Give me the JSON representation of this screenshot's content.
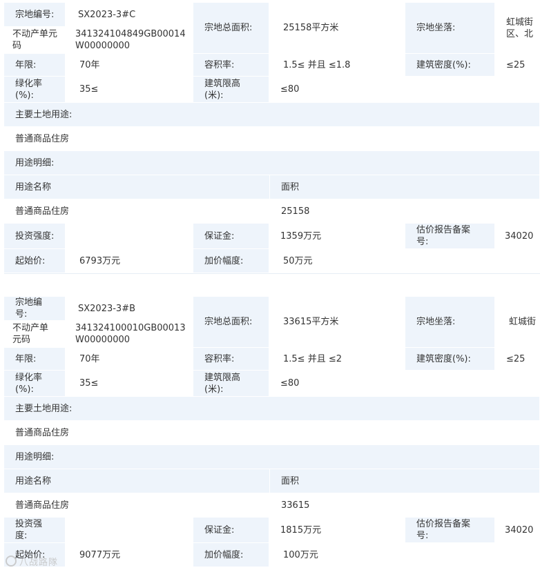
{
  "parcels": [
    {
      "parcel_no_label": "宗地编号:",
      "parcel_no": "SX2023-3#C",
      "unit_code_label": "不动产单元\n码",
      "unit_code": "341324104849GB00014\nW00000000",
      "total_area_label": "宗地总面积:",
      "total_area": "25158平方米",
      "location_label": "宗地坐落:",
      "location": "虹城街\n区、北",
      "term_label": "年限:",
      "term": "70年",
      "far_label": "容积率:",
      "far": "1.5≤ 并且 ≤1.8",
      "density_label": "建筑密度(%):",
      "density": "≤25",
      "green_label": "绿化率\n(%):",
      "green": "35≤",
      "height_label": "建筑限高\n(米):",
      "height": "≤80",
      "main_use_label": "主要土地用途:",
      "main_use": "普通商品住房",
      "use_detail_label": "用途明细:",
      "use_name_header": "用途名称",
      "area_header": "面积",
      "use_name": "普通商品住房",
      "use_area": "25158",
      "invest_label": "投资强度:",
      "invest": "",
      "deposit_label": "保证金:",
      "deposit": "1359万元",
      "appraisal_label": "估价报告备案\n号:",
      "appraisal": "34020",
      "start_price_label": "起始价:",
      "start_price": "6793万元",
      "increment_label": "加价幅度:",
      "increment": "50万元"
    },
    {
      "parcel_no_label": "宗地编\n号:",
      "parcel_no": "SX2023-3#B",
      "unit_code_label": "不动产单\n元码",
      "unit_code": "341324100010GB00013\nW00000000",
      "total_area_label": "宗地总面积:",
      "total_area": "33615平方米",
      "location_label": "宗地坐落:",
      "location": "虹城街",
      "term_label": "年限:",
      "term": "70年",
      "far_label": "容积率:",
      "far": "1.5≤ 并且 ≤2",
      "density_label": "建筑密度(%):",
      "density": "≤25",
      "green_label": "绿化率\n(%):",
      "green": "35≤",
      "height_label": "建筑限高\n(米):",
      "height": "≤80",
      "main_use_label": "主要土地用途:",
      "main_use": "普通商品住房",
      "use_detail_label": "用途明细:",
      "use_name_header": "用途名称",
      "area_header": "面积",
      "use_name": "普通商品住房",
      "use_area": "33615",
      "invest_label": "投资强\n度:",
      "invest": "",
      "deposit_label": "保证金:",
      "deposit": "1815万元",
      "appraisal_label": "估价报告备案\n号:",
      "appraisal": "34020",
      "start_price_label": "起始价:",
      "start_price": "9077万元",
      "increment_label": "加价幅度:",
      "increment": "100万元"
    }
  ],
  "watermark": "八战路隊"
}
